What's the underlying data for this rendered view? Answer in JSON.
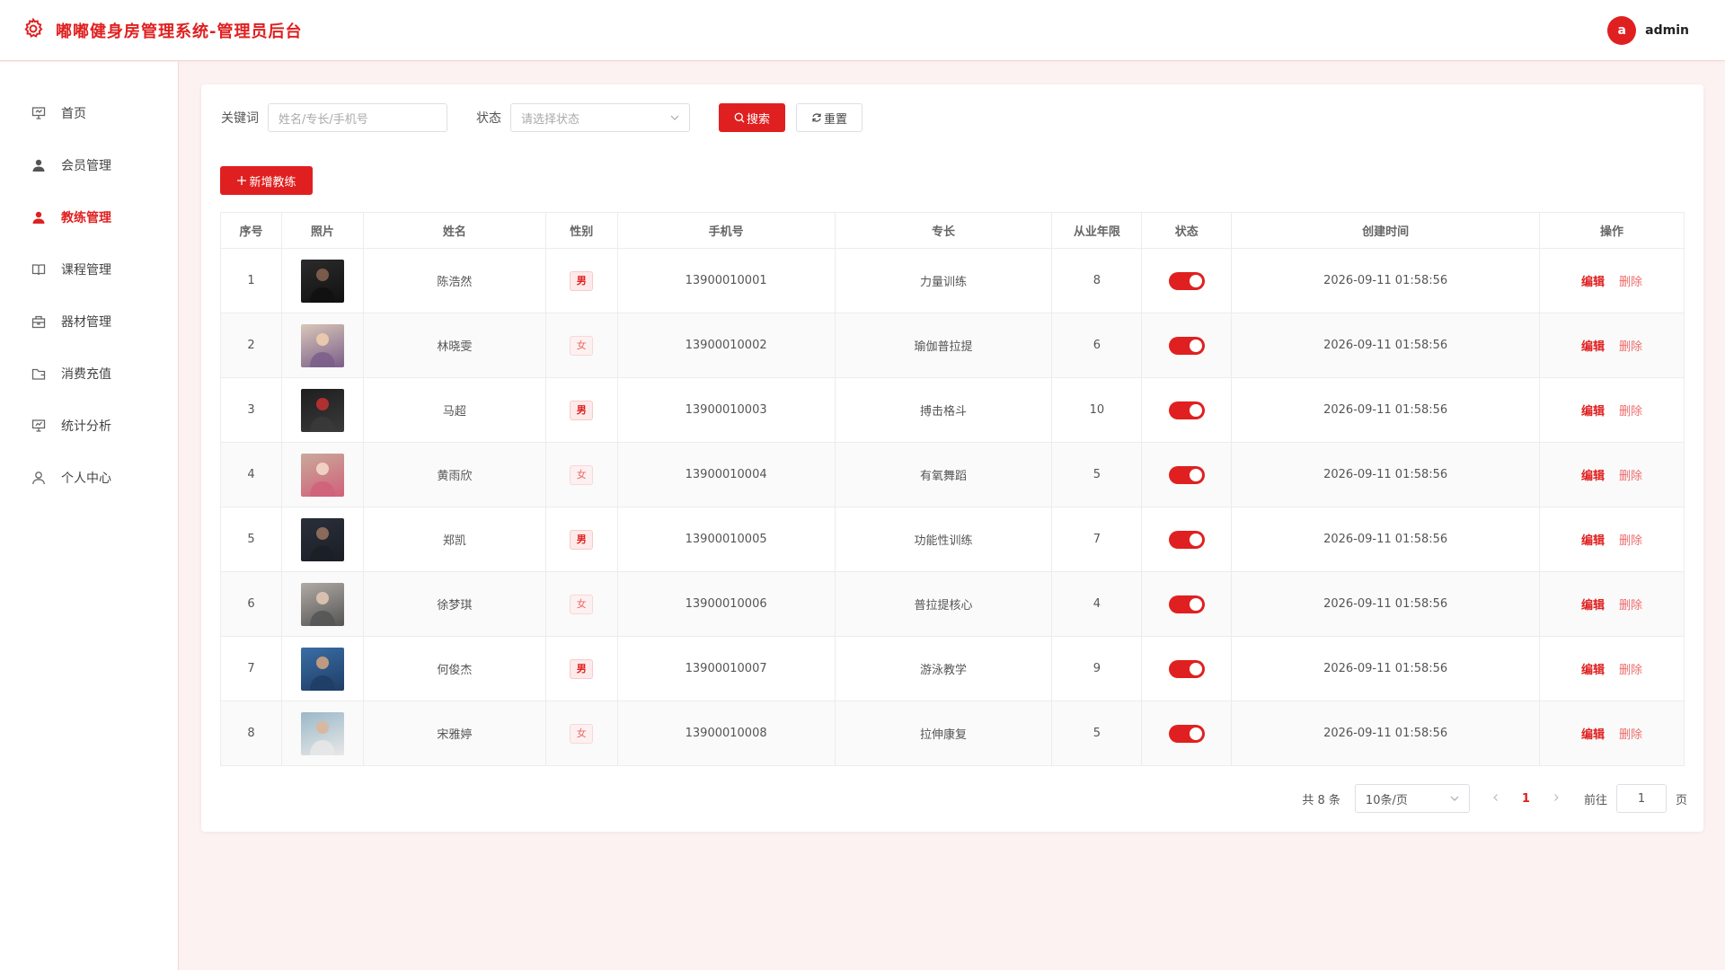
{
  "header": {
    "title": "嘟嘟健身房管理系统-管理员后台",
    "avatar_letter": "a",
    "username": "admin",
    "accent": "#e02020"
  },
  "sidebar": {
    "items": [
      {
        "label": "首页",
        "icon": "presentation-icon"
      },
      {
        "label": "会员管理",
        "icon": "user-icon"
      },
      {
        "label": "教练管理",
        "icon": "user-icon",
        "active": true
      },
      {
        "label": "课程管理",
        "icon": "book-icon"
      },
      {
        "label": "器材管理",
        "icon": "box-icon"
      },
      {
        "label": "消费充值",
        "icon": "wallet-icon"
      },
      {
        "label": "统计分析",
        "icon": "chart-icon"
      },
      {
        "label": "个人中心",
        "icon": "person-outline-icon"
      }
    ]
  },
  "filters": {
    "keyword_label": "关键词",
    "keyword_placeholder": "姓名/专长/手机号",
    "status_label": "状态",
    "status_placeholder": "请选择状态",
    "search_label": "搜索",
    "reset_label": "重置"
  },
  "add_button": "新增教练",
  "table": {
    "headers": [
      "序号",
      "照片",
      "姓名",
      "性别",
      "手机号",
      "专长",
      "从业年限",
      "状态",
      "创建时间",
      "操作"
    ],
    "edit_label": "编辑",
    "delete_label": "删除",
    "rows": [
      {
        "no": "1",
        "name": "陈浩然",
        "gender": "男",
        "phone": "13900010001",
        "specialty": "力量训练",
        "years": "8",
        "status": true,
        "created": "2026-09-11 01:58:56"
      },
      {
        "no": "2",
        "name": "林晓雯",
        "gender": "女",
        "phone": "13900010002",
        "specialty": "瑜伽普拉提",
        "years": "6",
        "status": true,
        "created": "2026-09-11 01:58:56"
      },
      {
        "no": "3",
        "name": "马超",
        "gender": "男",
        "phone": "13900010003",
        "specialty": "搏击格斗",
        "years": "10",
        "status": true,
        "created": "2026-09-11 01:58:56"
      },
      {
        "no": "4",
        "name": "黄雨欣",
        "gender": "女",
        "phone": "13900010004",
        "specialty": "有氧舞蹈",
        "years": "5",
        "status": true,
        "created": "2026-09-11 01:58:56"
      },
      {
        "no": "5",
        "name": "郑凯",
        "gender": "男",
        "phone": "13900010005",
        "specialty": "功能性训练",
        "years": "7",
        "status": true,
        "created": "2026-09-11 01:58:56"
      },
      {
        "no": "6",
        "name": "徐梦琪",
        "gender": "女",
        "phone": "13900010006",
        "specialty": "普拉提核心",
        "years": "4",
        "status": true,
        "created": "2026-09-11 01:58:56"
      },
      {
        "no": "7",
        "name": "何俊杰",
        "gender": "男",
        "phone": "13900010007",
        "specialty": "游泳教学",
        "years": "9",
        "status": true,
        "created": "2026-09-11 01:58:56"
      },
      {
        "no": "8",
        "name": "宋雅婷",
        "gender": "女",
        "phone": "13900010008",
        "specialty": "拉伸康复",
        "years": "5",
        "status": true,
        "created": "2026-09-11 01:58:56"
      }
    ]
  },
  "pagination": {
    "total_text": "共 8 条",
    "page_size": "10条/页",
    "current": "1",
    "goto_label": "前往",
    "goto_value": "1",
    "page_suffix": "页"
  }
}
